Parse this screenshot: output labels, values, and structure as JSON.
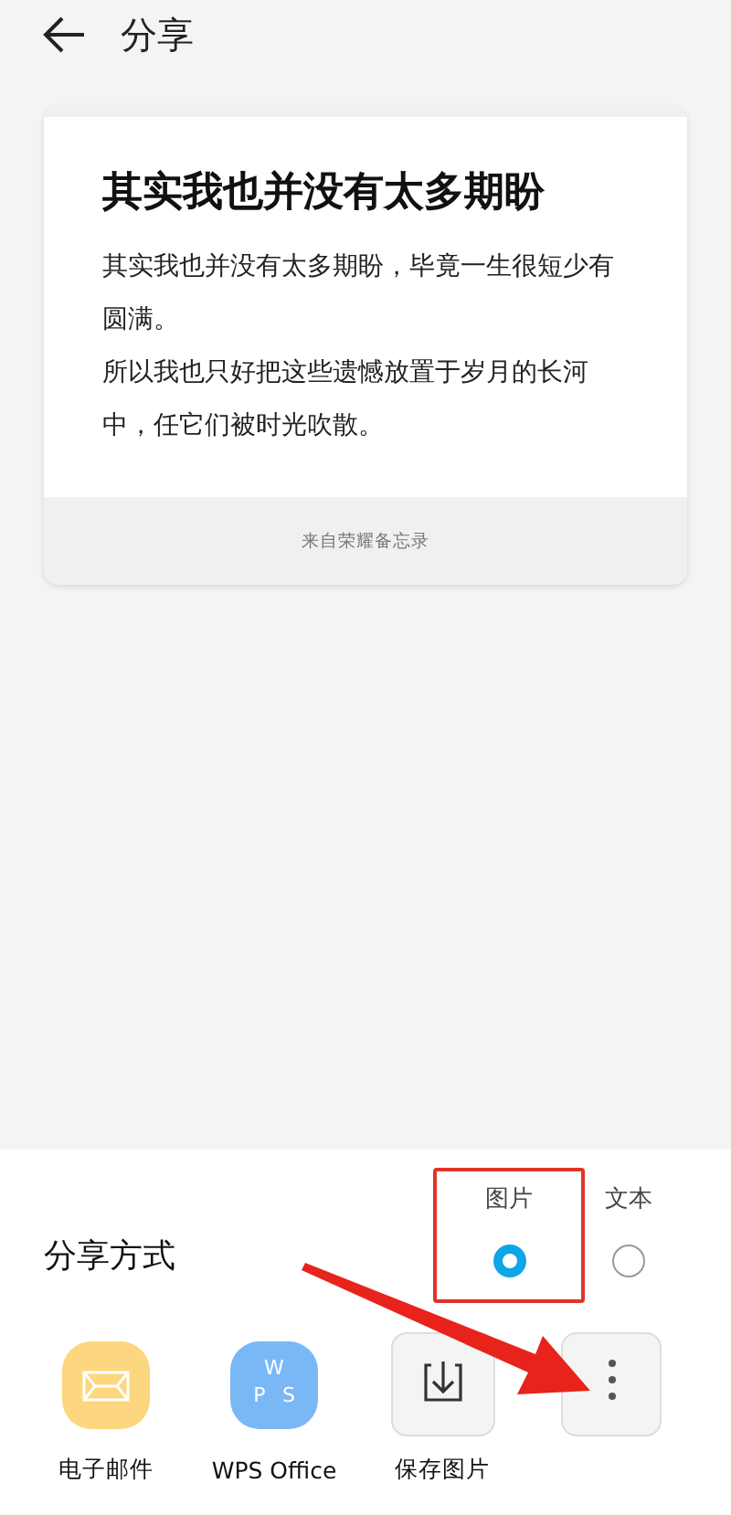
{
  "header": {
    "title": "分享"
  },
  "note": {
    "title": "其实我也并没有太多期盼",
    "paragraphs": [
      "其实我也并没有太多期盼，毕竟一生很短少有圆满。",
      "所以我也只好把这些遗憾放置于岁月的长河中，任它们被时光吹散。"
    ],
    "footer": "来自荣耀备忘录"
  },
  "share_sheet": {
    "title": "分享方式",
    "options": [
      {
        "label": "图片",
        "selected": true,
        "highlighted": true
      },
      {
        "label": "文本",
        "selected": false,
        "highlighted": false
      }
    ],
    "apps": [
      {
        "kind": "mail",
        "label": "电子邮件"
      },
      {
        "kind": "wps",
        "label": "WPS Office",
        "icon_letters": [
          "W",
          "P",
          "S"
        ]
      },
      {
        "kind": "save",
        "label": "保存图片"
      },
      {
        "kind": "more"
      }
    ]
  }
}
